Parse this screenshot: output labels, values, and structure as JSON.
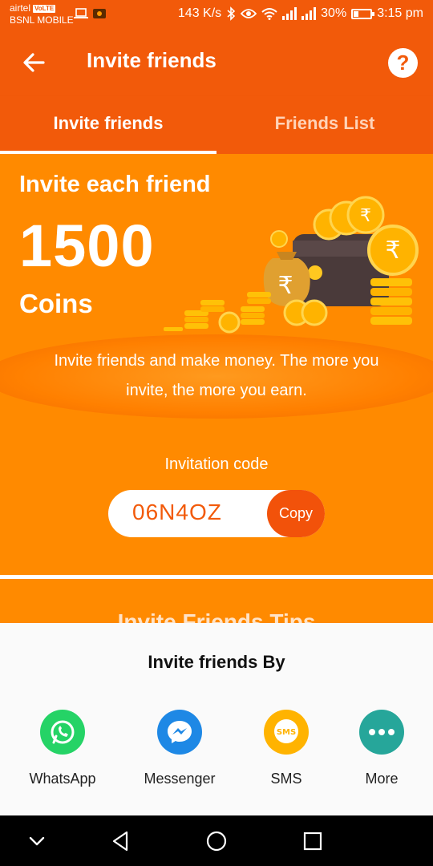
{
  "status_bar": {
    "carrier_1": "airtel",
    "volte_badge": "VoLTE",
    "carrier_2": "BSNL MOBILE",
    "net_speed": "143 K/s",
    "battery_percent": "30%",
    "battery_level": 0.3,
    "time": "3:15 pm"
  },
  "app_bar": {
    "title": "Invite friends",
    "help_icon_text": "?"
  },
  "tabs": [
    {
      "label": "Invite friends",
      "active": true
    },
    {
      "label": "Friends List",
      "active": false
    }
  ],
  "hero": {
    "heading": "Invite each friend",
    "amount": "1500",
    "unit": "Coins",
    "description": "Invite friends and make money. The more you invite, the more you earn.",
    "code_label": "Invitation code",
    "code_value": "06N4OZ",
    "copy_label": "Copy"
  },
  "tips_title": "Invite Friends Tips",
  "share_sheet": {
    "title": "Invite friends By",
    "options": [
      {
        "label": "WhatsApp",
        "icon": "whatsapp-icon",
        "color": "#25d366"
      },
      {
        "label": "Messenger",
        "icon": "messenger-icon",
        "color": "#1e88e5"
      },
      {
        "label": "SMS",
        "icon": "sms-icon",
        "color": "#ffb300"
      },
      {
        "label": "More",
        "icon": "more-icon",
        "color": "#26a69a"
      }
    ]
  },
  "colors": {
    "primary": "#f25a0a",
    "hero_bg": "#ff8a00",
    "sheet_bg": "#fafafa"
  }
}
